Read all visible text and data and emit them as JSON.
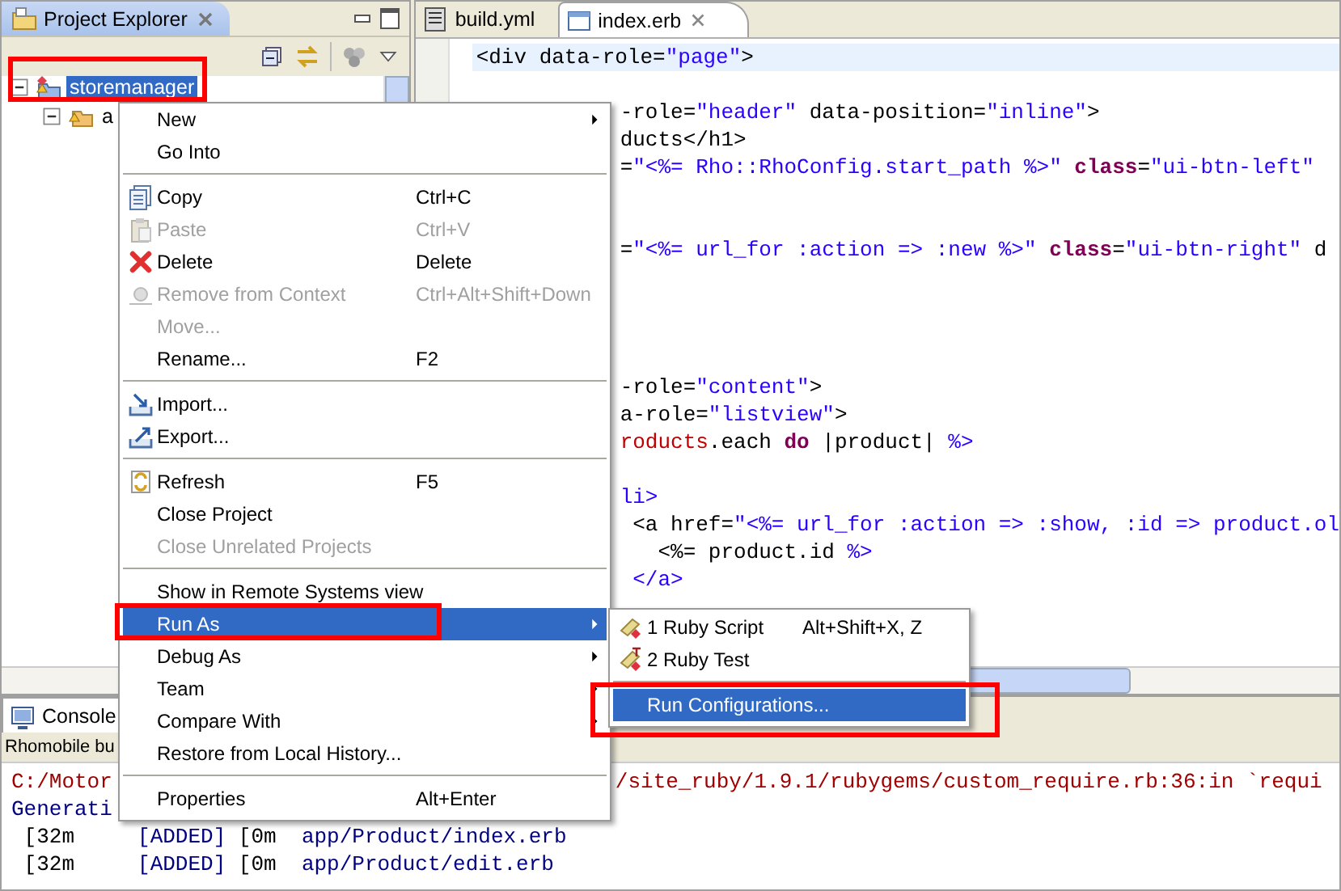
{
  "explorer": {
    "title": "Project Explorer",
    "tree": [
      {
        "label": "storemanager",
        "selected": true,
        "highlighted": true,
        "expanded": true,
        "children": [
          {
            "label": "a",
            "selected": false,
            "highlighted": false,
            "expanded": true
          }
        ]
      }
    ]
  },
  "editor": {
    "tabs": [
      {
        "label": "build.yml",
        "selected": false
      },
      {
        "label": "index.erb",
        "selected": true
      }
    ],
    "lines": [
      {
        "kind": "full",
        "current": true,
        "segments": [
          {
            "kind": "plain",
            "text": "<div data-role="
          },
          {
            "kind": "str",
            "text": "\"page\""
          },
          {
            "kind": "plain",
            "text": ">"
          }
        ]
      },
      {
        "kind": "blank"
      },
      {
        "kind": "cut",
        "current": false,
        "segments": [
          {
            "kind": "plain",
            "text": "-role="
          },
          {
            "kind": "str",
            "text": "\"header\""
          },
          {
            "kind": "plain",
            "text": " data-position="
          },
          {
            "kind": "str",
            "text": "\"inline\""
          },
          {
            "kind": "plain",
            "text": ">"
          }
        ]
      },
      {
        "kind": "cut",
        "current": false,
        "segments": [
          {
            "kind": "plain",
            "text": "ducts</h1>"
          }
        ]
      },
      {
        "kind": "cut",
        "current": false,
        "segments": [
          {
            "kind": "plain",
            "text": "="
          },
          {
            "kind": "str",
            "text": "\"<%= Rho::RhoConfig.start_path %>\""
          },
          {
            "kind": "kw",
            "text": " class"
          },
          {
            "kind": "plain",
            "text": "="
          },
          {
            "kind": "str",
            "text": "\"ui-btn-left\""
          }
        ]
      },
      {
        "kind": "blank"
      },
      {
        "kind": "blank"
      },
      {
        "kind": "cut",
        "current": false,
        "segments": [
          {
            "kind": "plain",
            "text": "="
          },
          {
            "kind": "str",
            "text": "\"<%= url_for :action => :new %>\""
          },
          {
            "kind": "kw",
            "text": " class"
          },
          {
            "kind": "plain",
            "text": "="
          },
          {
            "kind": "str",
            "text": "\"ui-btn-right\""
          },
          {
            "kind": "plain",
            "text": " d"
          }
        ]
      },
      {
        "kind": "blank"
      },
      {
        "kind": "blank"
      },
      {
        "kind": "blank"
      },
      {
        "kind": "blank"
      },
      {
        "kind": "cut",
        "current": false,
        "segments": [
          {
            "kind": "plain",
            "text": "-role="
          },
          {
            "kind": "str",
            "text": "\"content\""
          },
          {
            "kind": "plain",
            "text": ">"
          }
        ]
      },
      {
        "kind": "cut",
        "current": false,
        "segments": [
          {
            "kind": "plain",
            "text": "a-role="
          },
          {
            "kind": "str",
            "text": "\"listview\""
          },
          {
            "kind": "plain",
            "text": ">"
          }
        ]
      },
      {
        "kind": "cut",
        "current": false,
        "segments": [
          {
            "kind": "ivar",
            "text": "roducts"
          },
          {
            "kind": "plain",
            "text": ".each "
          },
          {
            "kind": "kw",
            "text": "do"
          },
          {
            "kind": "plain",
            "text": " |product| "
          },
          {
            "kind": "str",
            "text": "%>"
          }
        ]
      },
      {
        "kind": "blank"
      },
      {
        "kind": "cut",
        "current": false,
        "segments": [
          {
            "kind": "str",
            "text": "li>"
          }
        ]
      },
      {
        "kind": "cut",
        "current": false,
        "segments": [
          {
            "kind": "plain",
            "text": " <a href="
          },
          {
            "kind": "str",
            "text": "\"<%= url_for :action => :show, :id => product.ol"
          }
        ]
      },
      {
        "kind": "cut",
        "current": false,
        "segments": [
          {
            "kind": "plain",
            "text": "   <%= product.id "
          },
          {
            "kind": "str",
            "text": "%>"
          }
        ]
      },
      {
        "kind": "cut",
        "current": false,
        "segments": [
          {
            "kind": "str",
            "text": " </a>"
          }
        ]
      }
    ]
  },
  "console": {
    "tab": "Console",
    "description": "Rhomobile bu",
    "lines": [
      {
        "kind": "split",
        "parts": [
          {
            "kind": "err",
            "text": "C:/Motor"
          },
          {
            "kind": "err",
            "text": "/site_ruby/1.9.1/rubygems/custom_require.rb:36:in `requi"
          }
        ]
      },
      {
        "parts": [
          {
            "kind": "info",
            "text": "Generati"
          }
        ]
      },
      {
        "parts": [
          {
            "kind": "plain",
            "text": " [32m     "
          },
          {
            "kind": "info",
            "text": "[ADDED]"
          },
          {
            "kind": "plain",
            "text": " [0m  "
          },
          {
            "kind": "info",
            "text": "app/Product/index.erb"
          }
        ]
      },
      {
        "parts": [
          {
            "kind": "plain",
            "text": " [32m     "
          },
          {
            "kind": "info",
            "text": "[ADDED]"
          },
          {
            "kind": "plain",
            "text": " [0m  "
          },
          {
            "kind": "info",
            "text": "app/Product/edit.erb"
          }
        ]
      }
    ]
  },
  "context_menu": {
    "items": [
      {
        "kind": "item",
        "label": "New",
        "submenu": true,
        "disabled": false,
        "selected": false,
        "highlighted": false
      },
      {
        "kind": "item",
        "label": "Go Into",
        "submenu": false,
        "disabled": false,
        "selected": false,
        "highlighted": false
      },
      {
        "kind": "separator"
      },
      {
        "kind": "item",
        "label": "Copy",
        "shortcut": "Ctrl+C",
        "submenu": false,
        "disabled": false,
        "selected": false,
        "highlighted": false
      },
      {
        "kind": "item",
        "label": "Paste",
        "shortcut": "Ctrl+V",
        "submenu": false,
        "disabled": true,
        "selected": false,
        "highlighted": false
      },
      {
        "kind": "item",
        "label": "Delete",
        "shortcut": "Delete",
        "submenu": false,
        "disabled": false,
        "selected": false,
        "highlighted": false
      },
      {
        "kind": "item",
        "label": "Remove from Context",
        "shortcut": "Ctrl+Alt+Shift+Down",
        "submenu": false,
        "disabled": true,
        "selected": false,
        "highlighted": false
      },
      {
        "kind": "item",
        "label": "Move...",
        "submenu": false,
        "disabled": true,
        "selected": false,
        "highlighted": false
      },
      {
        "kind": "item",
        "label": "Rename...",
        "shortcut": "F2",
        "submenu": false,
        "disabled": false,
        "selected": false,
        "highlighted": false
      },
      {
        "kind": "separator"
      },
      {
        "kind": "item",
        "label": "Import...",
        "submenu": false,
        "disabled": false,
        "selected": false,
        "highlighted": false
      },
      {
        "kind": "item",
        "label": "Export...",
        "submenu": false,
        "disabled": false,
        "selected": false,
        "highlighted": false
      },
      {
        "kind": "separator"
      },
      {
        "kind": "item",
        "label": "Refresh",
        "shortcut": "F5",
        "submenu": false,
        "disabled": false,
        "selected": false,
        "highlighted": false
      },
      {
        "kind": "item",
        "label": "Close Project",
        "submenu": false,
        "disabled": false,
        "selected": false,
        "highlighted": false
      },
      {
        "kind": "item",
        "label": "Close Unrelated Projects",
        "submenu": false,
        "disabled": true,
        "selected": false,
        "highlighted": false
      },
      {
        "kind": "separator"
      },
      {
        "kind": "item",
        "label": "Show in Remote Systems view",
        "submenu": false,
        "disabled": false,
        "selected": false,
        "highlighted": false
      },
      {
        "kind": "item",
        "label": "Run As",
        "submenu": true,
        "disabled": false,
        "selected": true,
        "highlighted": true
      },
      {
        "kind": "item",
        "label": "Debug As",
        "submenu": true,
        "disabled": false,
        "selected": false,
        "highlighted": false
      },
      {
        "kind": "item",
        "label": "Team",
        "submenu": true,
        "disabled": false,
        "selected": false,
        "highlighted": false
      },
      {
        "kind": "item",
        "label": "Compare With",
        "submenu": true,
        "disabled": false,
        "selected": false,
        "highlighted": false
      },
      {
        "kind": "item",
        "label": "Restore from Local History...",
        "submenu": false,
        "disabled": false,
        "selected": false,
        "highlighted": false
      },
      {
        "kind": "separator"
      },
      {
        "kind": "item",
        "label": "Properties",
        "shortcut": "Alt+Enter",
        "submenu": false,
        "disabled": false,
        "selected": false,
        "highlighted": false
      }
    ]
  },
  "submenu": {
    "items": [
      {
        "kind": "item",
        "label": "1 Ruby Script",
        "shortcut": "Alt+Shift+X, Z",
        "selected": false,
        "highlighted": false
      },
      {
        "kind": "item",
        "label": "2 Ruby Test",
        "selected": false,
        "highlighted": false
      },
      {
        "kind": "separator"
      },
      {
        "kind": "item",
        "label": "Run Configurations...",
        "selected": true,
        "highlighted": true
      }
    ]
  }
}
